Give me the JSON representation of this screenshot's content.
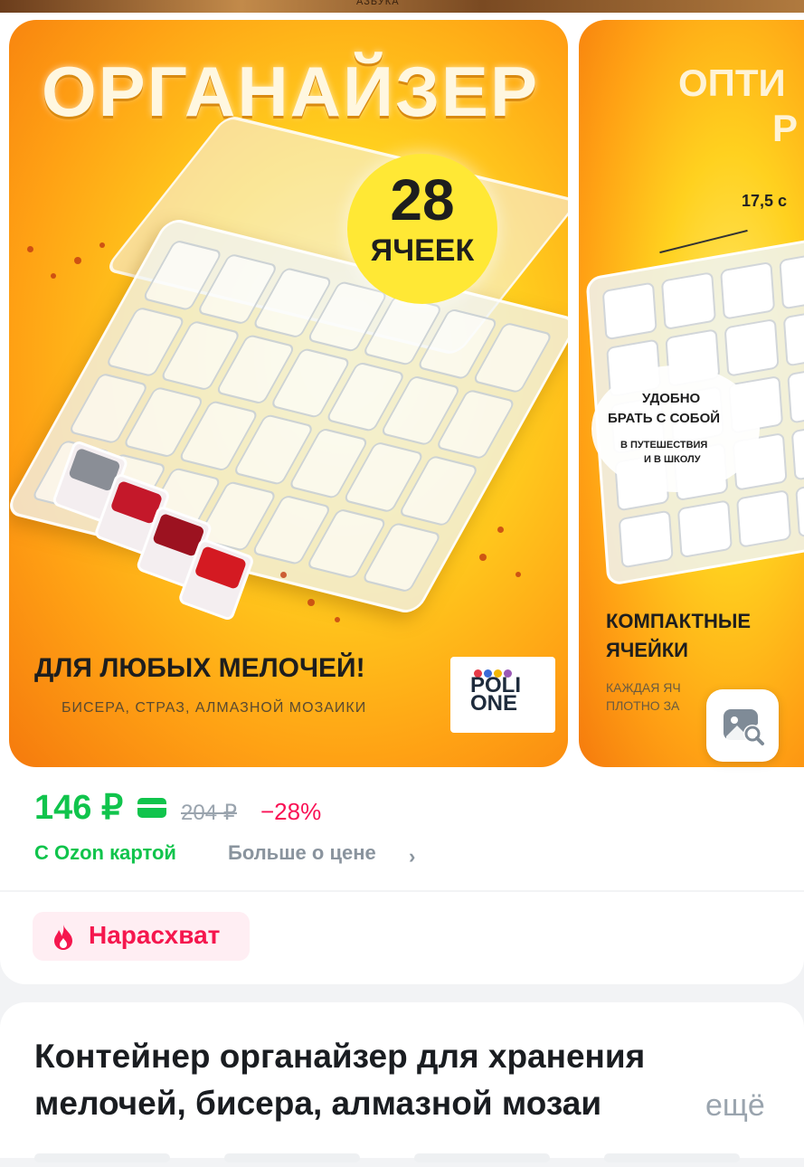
{
  "top_strip": {
    "text": "АЗБУКА"
  },
  "gallery": {
    "slide1": {
      "title": "ОРГАНАЙЗЕР",
      "badge_number": "28",
      "badge_word": "ЯЧЕЕК",
      "footer": "ДЛЯ ЛЮБЫХ МЕЛОЧЕЙ!",
      "subfooter": "БИСЕРА, СТРАЗ, АЛМАЗНОЙ МОЗАИКИ",
      "brand_line1": "POLI",
      "brand_line2": "ONE",
      "brand_colors": [
        "#e63946",
        "#3a6bd6",
        "#f2b705",
        "#9b59b6"
      ]
    },
    "slide2": {
      "title_line1": "ОПТИ",
      "title_line2": "Р",
      "measure": "17,5 с",
      "bubble_line1": "УДОБНО",
      "bubble_line2": "БРАТЬ С СОБОЙ",
      "bubble_line3": "В ПУТЕШЕСТВИЯ",
      "bubble_line4": "И В ШКОЛУ",
      "footer_line1": "КОМПАКТНЫЕ",
      "footer_line2": "ЯЧЕЙКИ",
      "footer_line3": "КАЖДАЯ ЯЧ",
      "footer_line4": "ПЛОТНО ЗА"
    },
    "search_icon": "image-search-icon"
  },
  "price": {
    "current": "146 ₽",
    "old": "204 ₽",
    "discount": "−28%",
    "ozon_card_label": "С Ozon картой",
    "more_label": "Больше о цене",
    "accent_color": "#10c44c",
    "discount_color": "#f91155"
  },
  "badge": {
    "label": "Нарасхват",
    "icon": "flame-icon",
    "color": "#f5174e"
  },
  "product": {
    "title_line1": "Контейнер органайзер для хранения",
    "title_line2": "мелочей, бисера, алмазной мозаи",
    "more": "ещё"
  }
}
